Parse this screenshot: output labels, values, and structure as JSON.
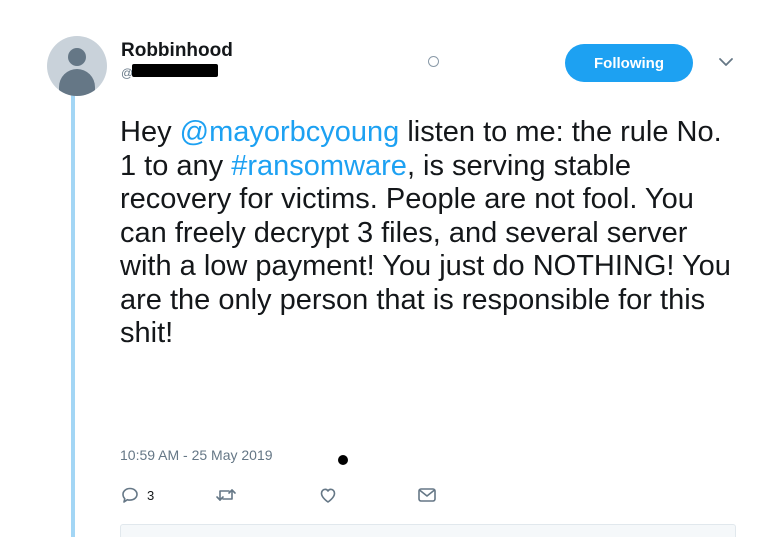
{
  "tweet": {
    "display_name": "Robbinhood",
    "handle_visible": "@",
    "follow_label": "Following",
    "text": {
      "line1_a": "Hey ",
      "mention": "@mayorbcyoung",
      "line1_b": " listen to me: the rule No. 1 to any ",
      "hashtag": "#ransomware",
      "line_rest": ", is serving stable recovery for victims. People are not fool. You can freely decrypt 3 files, and several server with a low payment! You just do NOTHING! You are the only person that is responsible for this shit!"
    },
    "timestamp": "10:59 AM - 25 May 2019",
    "reply_count": "3"
  },
  "colors": {
    "accent": "#1da1f2",
    "thread_line": "#a3d6f5",
    "muted": "#657786"
  },
  "icons": {
    "reply": "reply-icon",
    "retweet": "retweet-icon",
    "like": "heart-icon",
    "dm": "envelope-icon",
    "caret": "chevron-down-icon"
  }
}
